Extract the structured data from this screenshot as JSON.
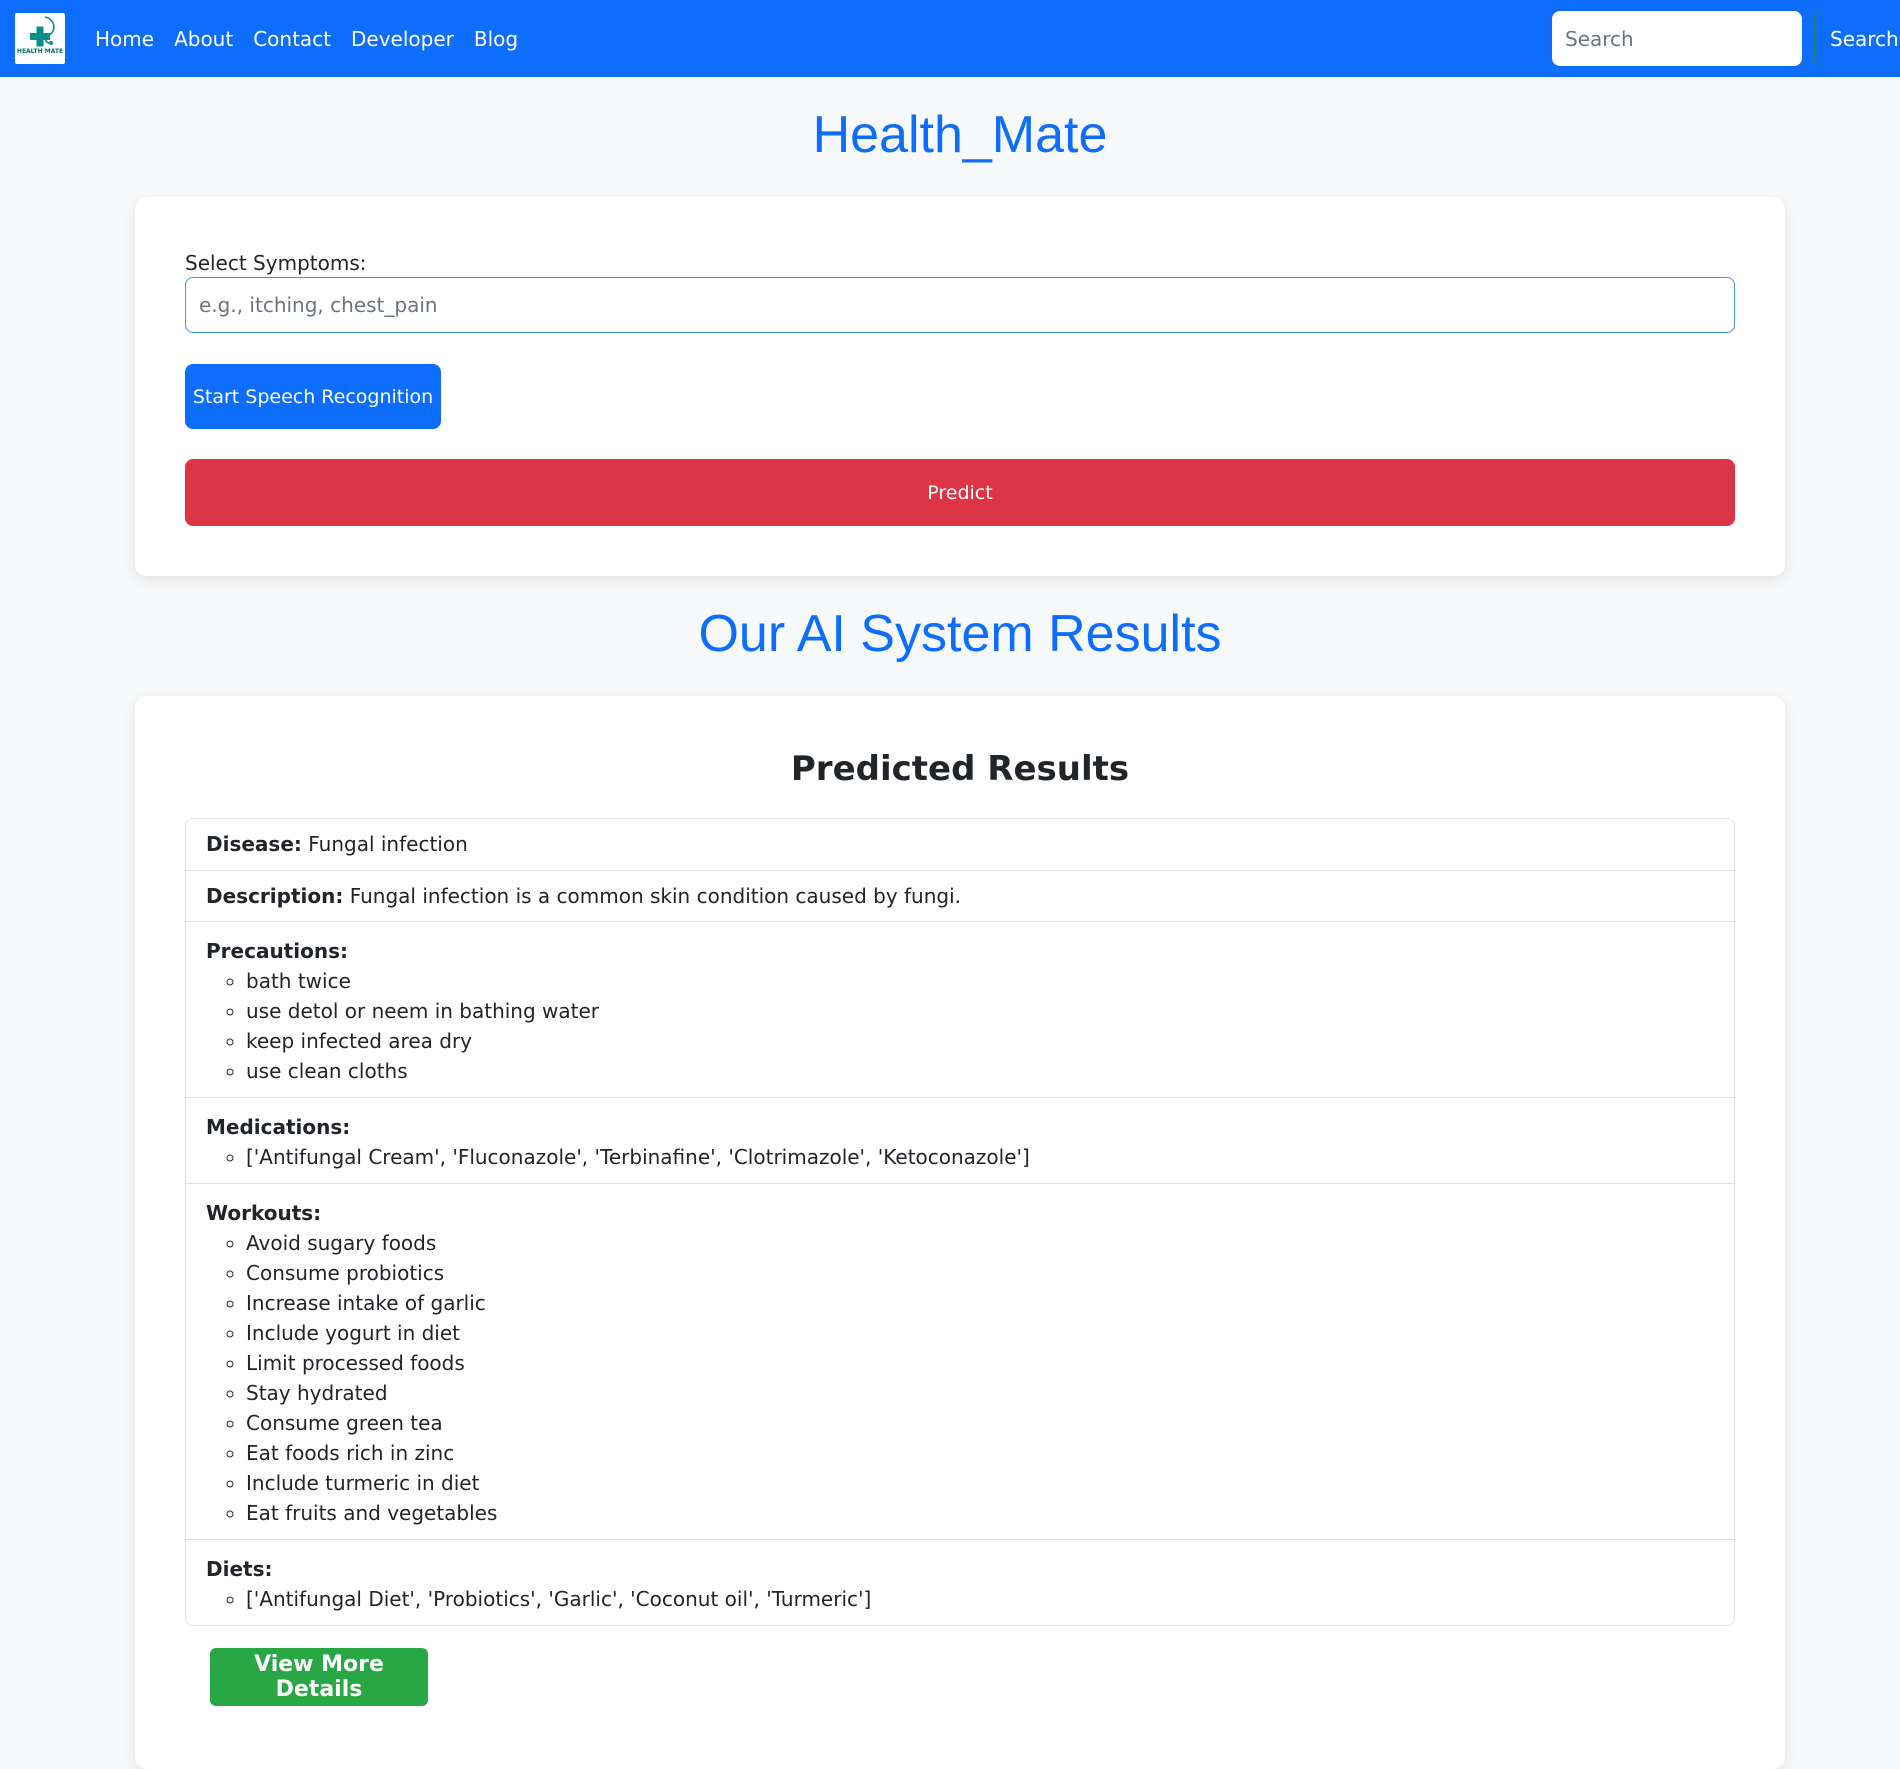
{
  "navbar": {
    "logo_text": "HEALTH MATE",
    "links": [
      "Home",
      "About",
      "Contact",
      "Developer",
      "Blog"
    ],
    "search_placeholder": "Search",
    "search_button": "Search",
    "brand_color": "#0d6efd"
  },
  "page_title": "Health_Mate",
  "form": {
    "label": "Select Symptoms:",
    "placeholder": "e.g., itching, chest_pain",
    "speech_button": "Start Speech Recognition",
    "predict_button": "Predict"
  },
  "section_title": "Our AI System Results",
  "results": {
    "heading": "Predicted Results",
    "disease_label": "Disease:",
    "disease": "Fungal infection",
    "description_label": "Description:",
    "description": "Fungal infection is a common skin condition caused by fungi.",
    "precautions_label": "Precautions:",
    "precautions": [
      "bath twice",
      "use detol or neem in bathing water",
      "keep infected area dry",
      "use clean cloths"
    ],
    "medications_label": "Medications:",
    "medications": [
      "['Antifungal Cream', 'Fluconazole', 'Terbinafine', 'Clotrimazole', 'Ketoconazole']"
    ],
    "workouts_label": "Workouts:",
    "workouts": [
      "Avoid sugary foods",
      "Consume probiotics",
      "Increase intake of garlic",
      "Include yogurt in diet",
      "Limit processed foods",
      "Stay hydrated",
      "Consume green tea",
      "Eat foods rich in zinc",
      "Include turmeric in diet",
      "Eat fruits and vegetables"
    ],
    "diets_label": "Diets:",
    "diets": [
      "['Antifungal Diet', 'Probiotics', 'Garlic', 'Coconut oil', 'Turmeric']"
    ],
    "details_button": "View More Details"
  },
  "colors": {
    "primary": "#0d6efd",
    "danger": "#dc3545",
    "success": "#28a745"
  }
}
